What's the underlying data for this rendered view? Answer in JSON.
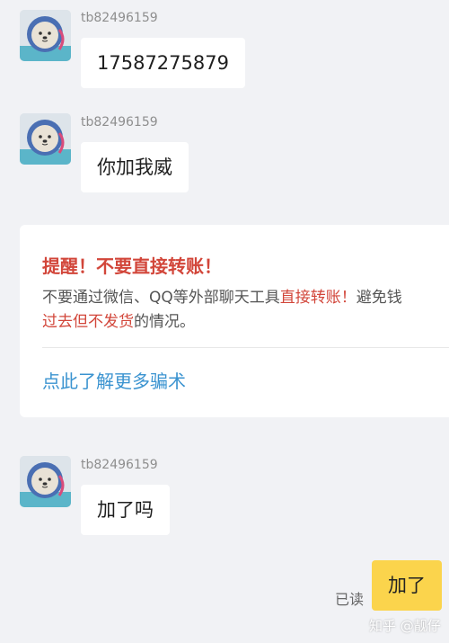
{
  "messages": [
    {
      "sender": "tb82496159",
      "text": "17587275879"
    },
    {
      "sender": "tb82496159",
      "text": "你加我威"
    },
    {
      "sender": "tb82496159",
      "text": "加了吗"
    }
  ],
  "warning_card": {
    "title": "提醒！不要直接转账！",
    "body_line1_part1": "不要通过微信、QQ等外部聊天工具",
    "body_line1_highlight": "直接转账！",
    "body_line1_part2": "避免钱",
    "body_line2_highlight": "过去但不发货",
    "body_line2_part2": "的情况。",
    "link_text": "点此了解更多骗术"
  },
  "own_message": {
    "text": "加了",
    "status": "已读"
  },
  "watermark": "知乎 @靓仔",
  "colors": {
    "background": "#f1f2f5",
    "warning_red": "#d2463a",
    "link_blue": "#3a93d0",
    "own_bubble": "#fbd44c"
  },
  "avatar_icon": "cartoon-seal-avatar-icon"
}
